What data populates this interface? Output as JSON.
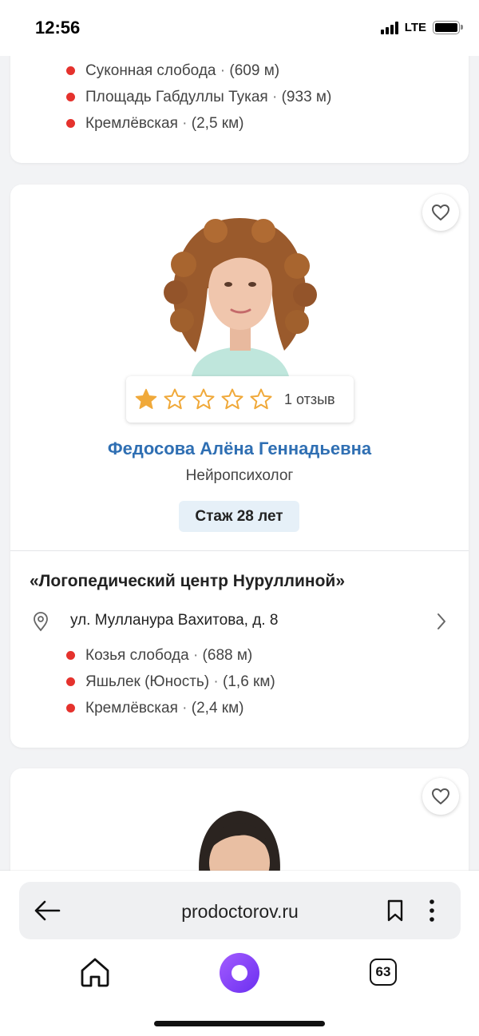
{
  "status_bar": {
    "time": "12:56",
    "network": "LTE"
  },
  "top_card": {
    "metro_stations": [
      {
        "name": "Суконная слобода",
        "distance": "(609 м)"
      },
      {
        "name": "Площадь Габдуллы Тукая",
        "distance": "(933 м)"
      },
      {
        "name": "Кремлёвская",
        "distance": "(2,5 км)"
      }
    ]
  },
  "doctor_card": {
    "rating": {
      "stars_filled": 1,
      "stars_total": 5,
      "reviews": "1 отзыв"
    },
    "name": "Федосова Алёна Геннадьевна",
    "specialty": "Нейропсихолог",
    "experience": "Стаж 28 лет",
    "clinic": {
      "name": "«Логопедический центр Нуруллиной»",
      "address": "ул. Мулланура Вахитова, д. 8",
      "metro_stations": [
        {
          "name": "Козья слобода",
          "distance": "(688 м)"
        },
        {
          "name": "Яшьлек (Юность)",
          "distance": "(1,6 км)"
        },
        {
          "name": "Кремлёвская",
          "distance": "(2,4 км)"
        }
      ]
    }
  },
  "browser": {
    "url": "prodoctorov.ru",
    "tabs_count": "63"
  },
  "colors": {
    "accent_link": "#2f6fb3",
    "metro_dot": "#e5322d",
    "star": "#f0a93a",
    "alice": "#8a3ffc",
    "badge_bg": "#e6f0f8"
  }
}
